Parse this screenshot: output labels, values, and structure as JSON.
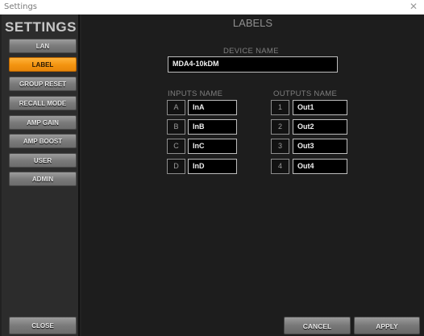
{
  "window": {
    "title": "Settings",
    "close_glyph": "✕"
  },
  "sidebar": {
    "title": "SETTINGS",
    "items": [
      {
        "label": "LAN",
        "active": false
      },
      {
        "label": "LABEL",
        "active": true
      },
      {
        "label": "GROUP RESET",
        "active": false
      },
      {
        "label": "RECALL MODE",
        "active": false
      },
      {
        "label": "AMP GAIN",
        "active": false
      },
      {
        "label": "AMP BOOST",
        "active": false
      },
      {
        "label": "USER",
        "active": false
      },
      {
        "label": "ADMIN",
        "active": false
      }
    ],
    "close_label": "CLOSE"
  },
  "main": {
    "title": "LABELS",
    "device_name_label": "DEVICE NAME",
    "device_name_value": "MDA4-10kDM",
    "inputs_label": "INPUTS NAME",
    "outputs_label": "OUTPUTS NAME",
    "inputs": [
      {
        "index": "A",
        "name": "InA"
      },
      {
        "index": "B",
        "name": "InB"
      },
      {
        "index": "C",
        "name": "InC"
      },
      {
        "index": "D",
        "name": "InD"
      }
    ],
    "outputs": [
      {
        "index": "1",
        "name": "Out1"
      },
      {
        "index": "2",
        "name": "Out2"
      },
      {
        "index": "3",
        "name": "Out3"
      },
      {
        "index": "4",
        "name": "Out4"
      }
    ],
    "cancel_label": "CANCEL",
    "apply_label": "APPLY"
  },
  "colors": {
    "accent": "#f39410",
    "background": "#1d1d1d",
    "sidebar": "#2c2c2c"
  }
}
